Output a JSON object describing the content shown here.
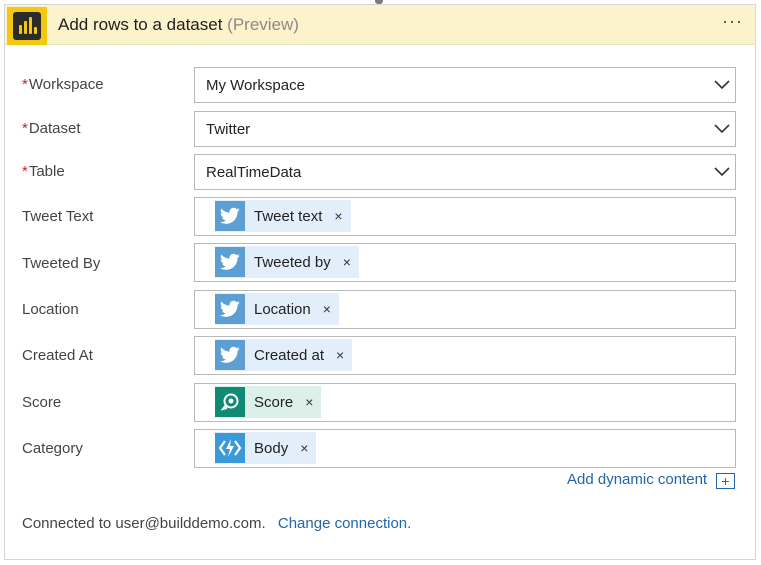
{
  "header": {
    "title": "Add rows to a dataset",
    "suffix": "(Preview)",
    "more_label": "···"
  },
  "fields": [
    {
      "label": "Workspace",
      "required": "*",
      "value": "My Workspace"
    },
    {
      "label": "Dataset",
      "required": "*",
      "value": "Twitter"
    },
    {
      "label": "Table",
      "required": "*",
      "value": "RealTimeData"
    },
    {
      "label": "Tweet Text",
      "token": "Tweet text",
      "icon": "twitter-icon"
    },
    {
      "label": "Tweeted By",
      "token": "Tweeted by",
      "icon": "twitter-icon"
    },
    {
      "label": "Location",
      "token": "Location",
      "icon": "twitter-icon"
    },
    {
      "label": "Created At",
      "token": "Created at",
      "icon": "twitter-icon"
    },
    {
      "label": "Score",
      "token": "Score",
      "icon": "cognitive-services-icon"
    },
    {
      "label": "Category",
      "token": "Body",
      "icon": "azure-functions-icon"
    }
  ],
  "token_close": "×",
  "dynamic": {
    "label": "Add dynamic content",
    "icon_glyph": "+"
  },
  "footer": {
    "connected_text": "Connected to user@builddemo.com.",
    "change_link": "Change connection."
  },
  "colors": {
    "header_bg": "#fbf3cc",
    "powerbi_yellow": "#f2c811",
    "twitter_blue": "#5d9fd3",
    "link_blue": "#2166a8",
    "required_red": "#c4262e"
  }
}
